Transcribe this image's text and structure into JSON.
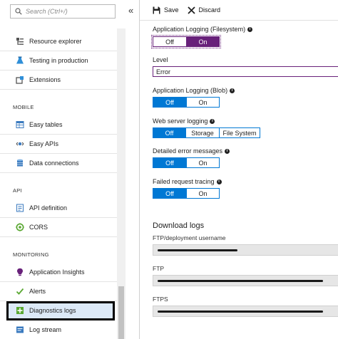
{
  "sidebar": {
    "search_placeholder": "Search (Ctrl+/)",
    "collapse_label": "«",
    "items": [
      {
        "label": "Resource explorer",
        "icon": "resource-explorer-icon"
      },
      {
        "label": "Testing in production",
        "icon": "flask-icon"
      },
      {
        "label": "Extensions",
        "icon": "extensions-icon"
      }
    ],
    "sections": [
      {
        "title": "MOBILE",
        "items": [
          {
            "label": "Easy tables",
            "icon": "table-icon"
          },
          {
            "label": "Easy APIs",
            "icon": "api-icon"
          },
          {
            "label": "Data connections",
            "icon": "database-icon"
          }
        ]
      },
      {
        "title": "API",
        "items": [
          {
            "label": "API definition",
            "icon": "api-definition-icon"
          },
          {
            "label": "CORS",
            "icon": "cors-icon"
          }
        ]
      },
      {
        "title": "MONITORING",
        "items": [
          {
            "label": "Application Insights",
            "icon": "lightbulb-icon"
          },
          {
            "label": "Alerts",
            "icon": "check-alert-icon"
          },
          {
            "label": "Diagnostics logs",
            "icon": "diagnostics-icon"
          },
          {
            "label": "Log stream",
            "icon": "log-stream-icon"
          }
        ]
      }
    ]
  },
  "toolbar": {
    "save_label": "Save",
    "discard_label": "Discard"
  },
  "settings": {
    "app_logging_fs": {
      "label": "Application Logging (Filesystem)",
      "off": "Off",
      "on": "On",
      "selected": "On"
    },
    "level": {
      "label": "Level",
      "value": "Error"
    },
    "app_logging_blob": {
      "label": "Application Logging (Blob)",
      "off": "Off",
      "on": "On",
      "selected": "Off"
    },
    "web_server_logging": {
      "label": "Web server logging",
      "off": "Off",
      "storage": "Storage",
      "file_system": "File System",
      "selected": "Off"
    },
    "detailed_errors": {
      "label": "Detailed error messages",
      "off": "Off",
      "on": "On",
      "selected": "Off"
    },
    "failed_request_tracing": {
      "label": "Failed request tracing",
      "off": "Off",
      "on": "On",
      "selected": "Off"
    }
  },
  "download_logs": {
    "title": "Download logs",
    "ftp_user_label": "FTP/deployment username",
    "ftp_label": "FTP",
    "ftps_label": "FTPS"
  },
  "colors": {
    "accent_blue": "#0078d4",
    "accent_purple": "#68217a",
    "selected_bg": "#dce9f7"
  }
}
